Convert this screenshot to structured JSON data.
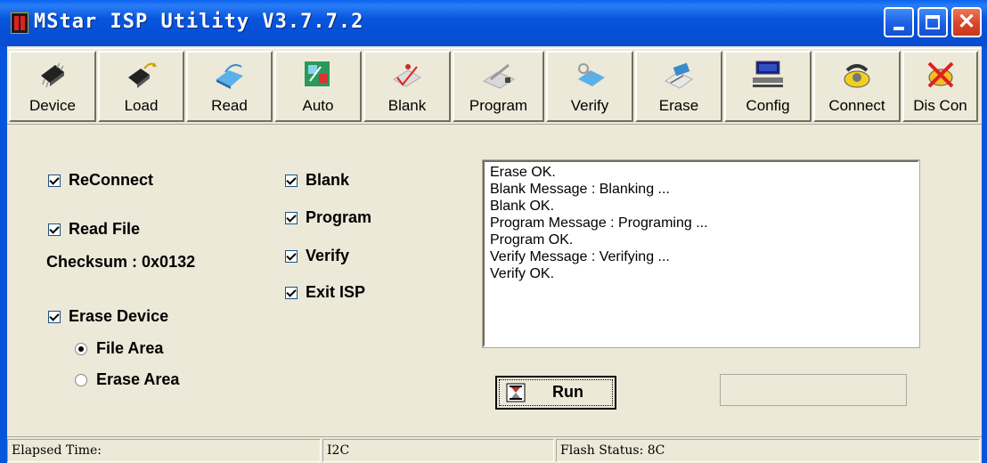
{
  "window": {
    "title": "MStar ISP Utility V3.7.7.2",
    "caption_buttons": [
      "minimize-icon",
      "maximize-icon",
      "close-icon"
    ],
    "close_glyph": "✕"
  },
  "toolbar": {
    "buttons": [
      {
        "label": "Device",
        "icon": "chip-icon"
      },
      {
        "label": "Load",
        "icon": "load-chip-icon"
      },
      {
        "label": "Read",
        "icon": "read-book-icon"
      },
      {
        "label": "Auto",
        "icon": "auto-icon"
      },
      {
        "label": "Blank",
        "icon": "blank-check-icon"
      },
      {
        "label": "Program",
        "icon": "program-icon"
      },
      {
        "label": "Verify",
        "icon": "verify-icon"
      },
      {
        "label": "Erase",
        "icon": "erase-icon"
      },
      {
        "label": "Config",
        "icon": "config-computer-icon"
      },
      {
        "label": "Connect",
        "icon": "connect-phone-icon"
      },
      {
        "label": "Dis Con",
        "icon": "disconnect-phone-icon"
      }
    ]
  },
  "options": {
    "reconnect": {
      "label": "ReConnect",
      "checked": true
    },
    "read_file": {
      "label": "Read File",
      "checked": true
    },
    "checksum": "Checksum : 0x0132",
    "erase_device": {
      "label": "Erase Device",
      "checked": true
    },
    "file_area": {
      "label": "File Area",
      "selected": true
    },
    "erase_area": {
      "label": "Erase Area",
      "selected": false
    },
    "blank": {
      "label": "Blank",
      "checked": true
    },
    "program": {
      "label": "Program",
      "checked": true
    },
    "verify": {
      "label": "Verify",
      "checked": true
    },
    "exit_isp": {
      "label": "Exit ISP",
      "checked": true
    }
  },
  "log": {
    "lines": [
      "Erase OK.",
      "Blank Message : Blanking ...",
      "Blank OK.",
      "Program Message : Programing ...",
      "Program OK.",
      "Verify Message : Verifying ...",
      "Verify OK."
    ]
  },
  "run_button": {
    "label": "Run",
    "icon": "hourglass-icon"
  },
  "statusbar": {
    "elapsed": "Elapsed Time:",
    "bus": "I2C",
    "flash_status": "Flash Status: 8C"
  },
  "colors": {
    "title_bar": "#0855dd",
    "window_bg": "#ece9d8",
    "close_button": "#d8452a"
  }
}
